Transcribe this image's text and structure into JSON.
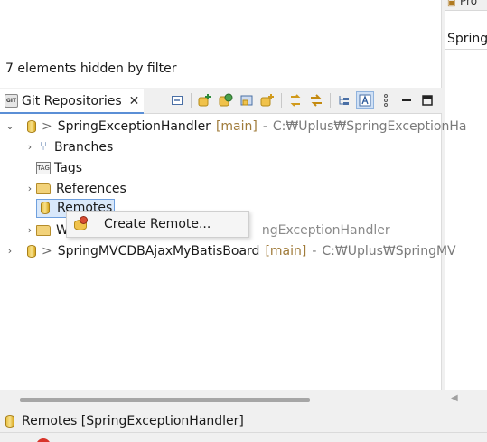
{
  "top_panel": {
    "filter_note": "7 elements hidden by filter"
  },
  "right_panel": {
    "tab_text": "Pro",
    "heading": "Spring"
  },
  "git_view": {
    "tab_title": "Git Repositories",
    "close_glyph": "✕",
    "toolbar_icons": [
      "collapse-all-icon",
      "add-repo-icon",
      "clone-repo-icon",
      "create-repo-icon",
      "import-project-icon",
      "link-with-selection-icon",
      "refresh-icon",
      "hierarchical-layout-icon",
      "show-details-icon",
      "view-menu-icon",
      "minimize-icon",
      "maximize-icon"
    ]
  },
  "tree": {
    "repo1": {
      "prefix": ">",
      "name": "SpringExceptionHandler",
      "branch": "[main]",
      "sep": "-",
      "path": "C:₩Uplus₩SpringExceptionHa"
    },
    "branches": "Branches",
    "tags": "Tags",
    "references": "References",
    "remotes": "Remotes",
    "working_tree_hidden": "W",
    "working_tree_tail": "ngExceptionHandler",
    "repo2": {
      "prefix": ">",
      "name": "SpringMVCDBAjaxMyBatisBoard",
      "branch": "[main]",
      "sep": "-",
      "path": "C:₩Uplus₩SpringMV"
    }
  },
  "context_menu": {
    "items": [
      {
        "label": "Create Remote..."
      }
    ]
  },
  "statusbar": {
    "text": "Remotes [SpringExceptionHandler]"
  },
  "colors": {
    "accent": "#5b8fd6",
    "selection": "#d9e8fa",
    "branch": "#a07b3a",
    "path": "#7a7a7a"
  }
}
